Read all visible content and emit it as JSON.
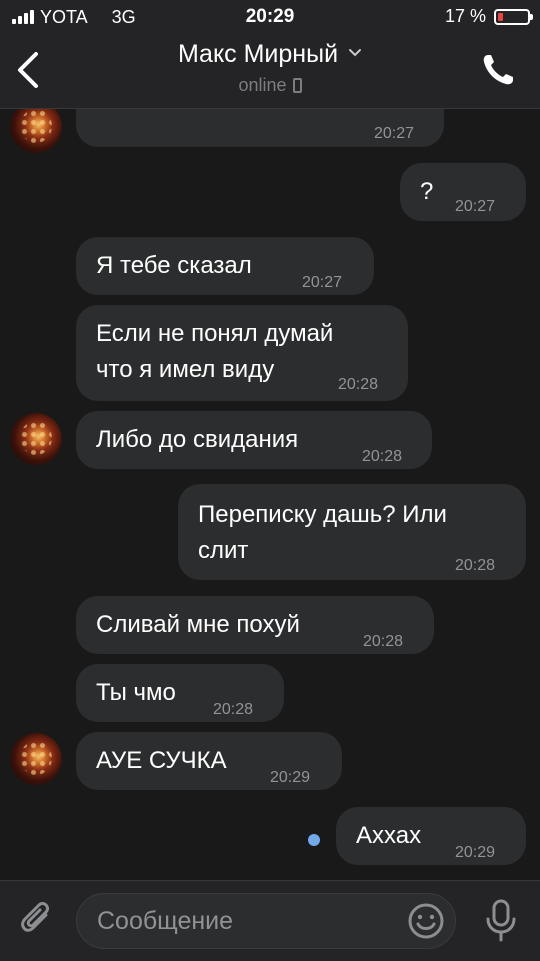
{
  "status_bar": {
    "carrier": "YOTA",
    "network": "3G",
    "time": "20:29",
    "battery_text": "17 %",
    "battery_level": 0.17,
    "colors": {
      "battery_low": "#e64646"
    }
  },
  "header": {
    "title": "Макс Мирный",
    "subtitle": "online",
    "icons": {
      "back": "chevron-left-icon",
      "title_menu": "chevron-down-icon",
      "device": "mobile-phone-icon",
      "call": "phone-icon"
    }
  },
  "messages": [
    {
      "side": "in",
      "text": "",
      "time": "20:27"
    },
    {
      "side": "out",
      "text": "?",
      "time": "20:27"
    },
    {
      "side": "in",
      "text": "Я тебе сказал",
      "time": "20:27"
    },
    {
      "side": "in",
      "lines": [
        "Если не понял думай",
        "что я имел виду"
      ],
      "time": "20:28"
    },
    {
      "side": "in",
      "text": "Либо до свидания",
      "time": "20:28"
    },
    {
      "side": "out",
      "lines": [
        "Переписку дашь? Или",
        "слит"
      ],
      "time": "20:28"
    },
    {
      "side": "in",
      "text": "Сливай мне похуй",
      "time": "20:28"
    },
    {
      "side": "in",
      "text": "Ты чмо",
      "time": "20:28"
    },
    {
      "side": "in",
      "text": "АУЕ СУЧКА",
      "time": "20:29"
    },
    {
      "side": "out",
      "text": "Аххах",
      "time": "20:29",
      "unread": true
    }
  ],
  "composer": {
    "placeholder": "Сообщение",
    "icons": {
      "attach": "paperclip-icon",
      "emoji": "smile-icon",
      "voice": "microphone-icon"
    }
  },
  "colors": {
    "background": "#19191a",
    "bar": "#242426",
    "bubble": "#2c2d2e",
    "unread_dot": "#71aaeb"
  }
}
